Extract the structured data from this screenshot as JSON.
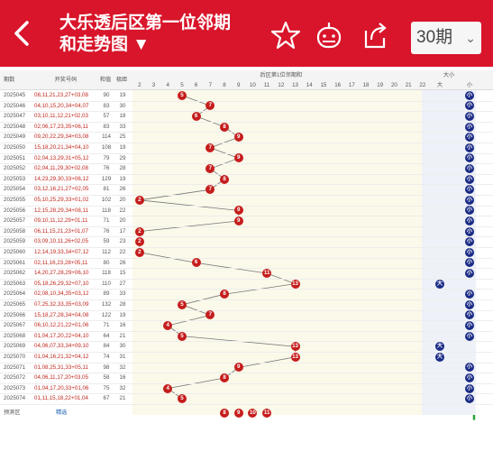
{
  "header": {
    "title_line1": "大乐透后区第一位邻期",
    "title_line2": "和走势图 ▼",
    "period_selector": "30期",
    "period_arrow": "⌄",
    "icons": [
      "back-arrow-icon",
      "star-icon",
      "robot-icon",
      "share-icon"
    ]
  },
  "table": {
    "col_issue": "期数",
    "col_numbers": "开奖号码",
    "col_sum": "和值",
    "col_span": "极距",
    "col_rear_title": "后区第1位邻期和",
    "col_size_title": "大小",
    "col_big": "大",
    "col_small": "小",
    "rear_headers": [
      "2",
      "3",
      "4",
      "5",
      "6",
      "7",
      "8",
      "9",
      "10",
      "11",
      "12",
      "13",
      "14",
      "15",
      "16",
      "17",
      "18",
      "19",
      "20",
      "21",
      "22"
    ],
    "rows": [
      {
        "issue": "2025045",
        "nums": "08,11,21,23,27+03,08",
        "sum": "90",
        "span": "19",
        "val": 5,
        "size": "小"
      },
      {
        "issue": "2025046",
        "nums": "04,10,15,20,34+04,07",
        "sum": "83",
        "span": "30",
        "val": 7,
        "size": "小"
      },
      {
        "issue": "2025047",
        "nums": "03,10,11,12,21+02,03",
        "sum": "57",
        "span": "18",
        "val": 6,
        "size": "小"
      },
      {
        "issue": "2025048",
        "nums": "02,06,17,23,35+06,11",
        "sum": "83",
        "span": "33",
        "val": 8,
        "size": "小"
      },
      {
        "issue": "2025049",
        "nums": "09,20,22,29,34+03,08",
        "sum": "114",
        "span": "25",
        "val": 9,
        "size": "小"
      },
      {
        "issue": "2025050",
        "nums": "15,18,20,21,34+04,10",
        "sum": "108",
        "span": "19",
        "val": 7,
        "size": "小"
      },
      {
        "issue": "2025051",
        "nums": "02,04,13,29,31+05,12",
        "sum": "79",
        "span": "29",
        "val": 9,
        "size": "小"
      },
      {
        "issue": "2025052",
        "nums": "02,04,11,29,30+02,08",
        "sum": "76",
        "span": "28",
        "val": 7,
        "size": "小"
      },
      {
        "issue": "2025053",
        "nums": "14,23,29,30,33+06,12",
        "sum": "129",
        "span": "19",
        "val": 8,
        "size": "小"
      },
      {
        "issue": "2025054",
        "nums": "03,12,16,21,27+02,05",
        "sum": "81",
        "span": "26",
        "val": 7,
        "size": "小"
      },
      {
        "issue": "2025055",
        "nums": "05,10,25,29,33+01,02",
        "sum": "102",
        "span": "20",
        "val": 2,
        "size": "小"
      },
      {
        "issue": "2025056",
        "nums": "12,15,28,29,34+08,11",
        "sum": "118",
        "span": "22",
        "val": 9,
        "size": "小"
      },
      {
        "issue": "2025057",
        "nums": "09,10,11,12,29+01,11",
        "sum": "71",
        "span": "20",
        "val": 9,
        "size": "小"
      },
      {
        "issue": "2025058",
        "nums": "06,11,15,21,23+01,07",
        "sum": "76",
        "span": "17",
        "val": 2,
        "size": "小"
      },
      {
        "issue": "2025059",
        "nums": "03,09,10,11,26+02,05",
        "sum": "59",
        "span": "23",
        "val": 2,
        "size": "小"
      },
      {
        "issue": "2025060",
        "nums": "12,14,19,33,34+07,12",
        "sum": "112",
        "span": "22",
        "val": 2,
        "size": "小"
      },
      {
        "issue": "2025061",
        "nums": "02,11,16,23,28+05,11",
        "sum": "80",
        "span": "26",
        "val": 6,
        "size": "小"
      },
      {
        "issue": "2025062",
        "nums": "14,20,27,28,29+06,10",
        "sum": "118",
        "span": "15",
        "val": 11,
        "size": "小"
      },
      {
        "issue": "2025063",
        "nums": "05,18,26,29,32+07,10",
        "sum": "110",
        "span": "27",
        "val": 13,
        "size": "大"
      },
      {
        "issue": "2025064",
        "nums": "02,08,10,34,35+03,12",
        "sum": "89",
        "span": "33",
        "val": 8,
        "size": "小"
      },
      {
        "issue": "2025065",
        "nums": "07,25,32,33,35+03,09",
        "sum": "132",
        "span": "28",
        "val": 5,
        "size": "小"
      },
      {
        "issue": "2025066",
        "nums": "15,18,27,28,34+04,08",
        "sum": "122",
        "span": "19",
        "val": 7,
        "size": "小"
      },
      {
        "issue": "2025067",
        "nums": "06,10,12,21,22+01,06",
        "sum": "71",
        "span": "16",
        "val": 4,
        "size": "小"
      },
      {
        "issue": "2025068",
        "nums": "01,04,17,20,22+04,10",
        "sum": "64",
        "span": "21",
        "val": 5,
        "size": "小"
      },
      {
        "issue": "2025069",
        "nums": "04,06,07,33,34+09,10",
        "sum": "84",
        "span": "30",
        "val": 13,
        "size": "大"
      },
      {
        "issue": "2025070",
        "nums": "01,04,16,21,32+04,12",
        "sum": "74",
        "span": "31",
        "val": 13,
        "size": "大"
      },
      {
        "issue": "2025071",
        "nums": "01,08,25,31,33+05,11",
        "sum": "98",
        "span": "32",
        "val": 9,
        "size": "小"
      },
      {
        "issue": "2025072",
        "nums": "04,06,11,17,20+03,05",
        "sum": "58",
        "span": "16",
        "val": 8,
        "size": "小"
      },
      {
        "issue": "2025073",
        "nums": "01,04,17,20,33+01,06",
        "sum": "75",
        "span": "32",
        "val": 4,
        "size": "小"
      },
      {
        "issue": "2025074",
        "nums": "01,11,15,18,22+01,04",
        "sum": "67",
        "span": "21",
        "val": 5,
        "size": "小"
      }
    ],
    "predict_label": "预测区",
    "predict_value": "精选",
    "predict_balls": [
      "8",
      "9",
      "10",
      "11"
    ]
  },
  "colors": {
    "accent": "#d8152a",
    "ball_red": "#c51d1d",
    "ball_blue": "#1a2b85",
    "trend_green": "#2aa43a"
  }
}
